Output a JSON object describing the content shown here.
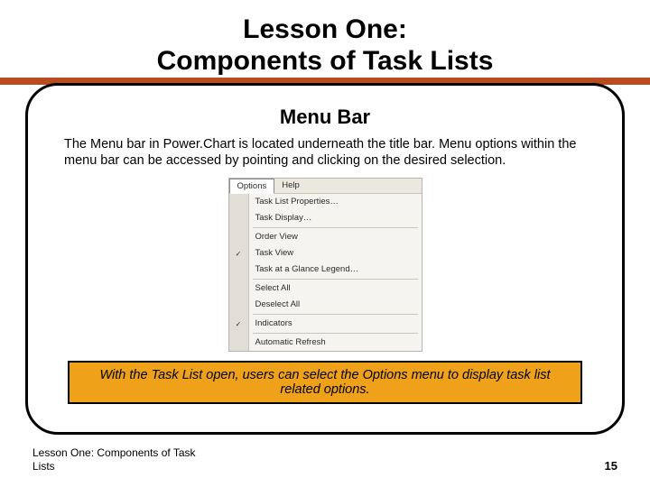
{
  "slide": {
    "title_line1": "Lesson One:",
    "title_line2": "Components of Task Lists",
    "section_heading": "Menu Bar",
    "body_text": "The Menu bar in Power.Chart is located underneath the title bar. Menu options within the menu bar can be accessed by pointing and clicking on the desired selection.",
    "callout": "With the Task List open, users can select the Options menu to display task list related options."
  },
  "menubar": {
    "items": [
      "Options",
      "Help"
    ],
    "active_index": 0
  },
  "dropdown": {
    "groups": [
      [
        "Task List Properties…",
        "Task Display…"
      ],
      [
        "Order View",
        "Task View",
        "Task at a Glance Legend…"
      ],
      [
        "Select All",
        "Deselect All"
      ],
      [
        "Indicators"
      ],
      [
        "Automatic Refresh"
      ]
    ],
    "checked_items": [
      "Task View",
      "Indicators"
    ]
  },
  "footer": {
    "left": "Lesson One: Components of Task Lists",
    "page": "15"
  }
}
